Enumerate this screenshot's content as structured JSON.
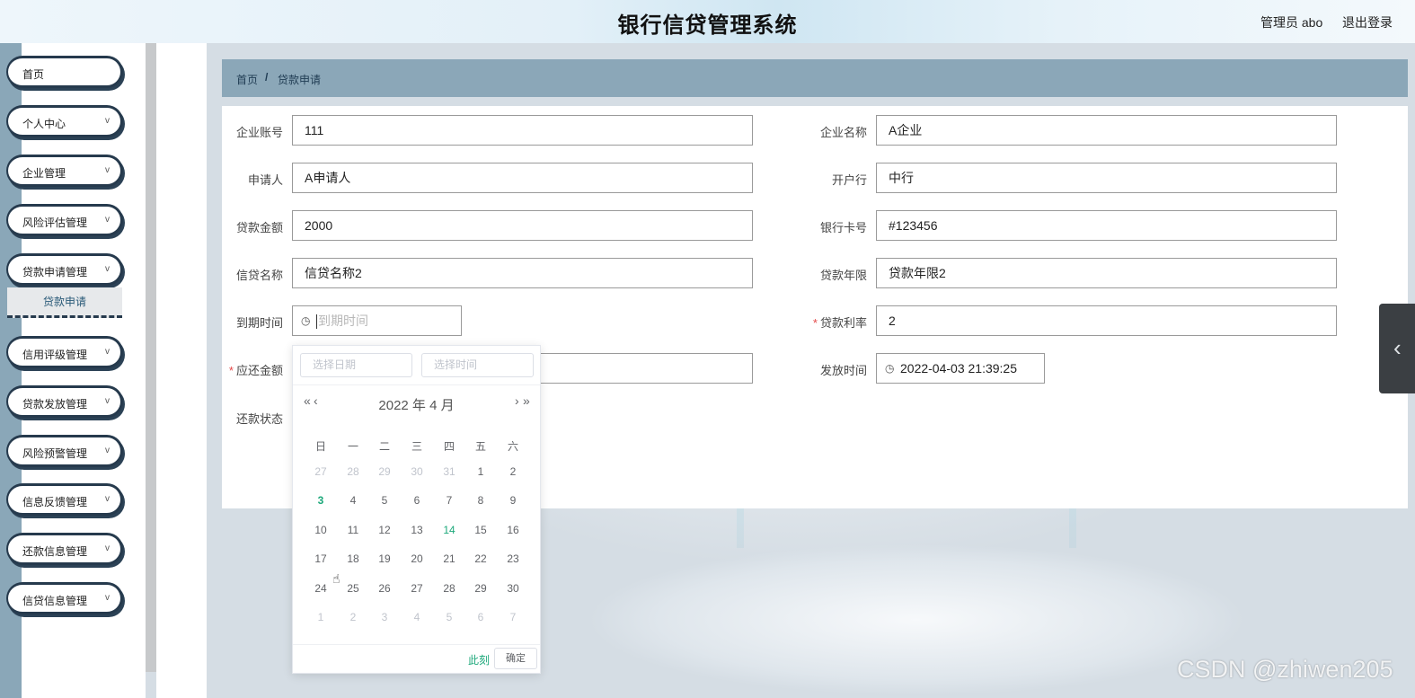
{
  "header": {
    "title": "银行信贷管理系统",
    "user": "管理员 abo",
    "logout": "退出登录"
  },
  "sidebar": {
    "items": [
      {
        "label": "首页"
      },
      {
        "label": "个人中心"
      },
      {
        "label": "企业管理"
      },
      {
        "label": "风险评估管理"
      },
      {
        "label": "贷款申请管理"
      },
      {
        "label": "信用评级管理"
      },
      {
        "label": "贷款发放管理"
      },
      {
        "label": "风险预警管理"
      },
      {
        "label": "信息反馈管理"
      },
      {
        "label": "还款信息管理"
      },
      {
        "label": "信贷信息管理"
      }
    ],
    "chevron": "v",
    "active_sub": "贷款申请"
  },
  "breadcrumb": {
    "home": "首页",
    "separator": "/",
    "current": "贷款申请"
  },
  "form": {
    "left": [
      {
        "label": "企业账号",
        "value": "111"
      },
      {
        "label": "申请人",
        "value": "A申请人"
      },
      {
        "label": "贷款金额",
        "value": "2000"
      },
      {
        "label": "信贷名称",
        "value": "信贷名称2"
      },
      {
        "label": "到期时间",
        "placeholder": "到期时间"
      },
      {
        "label": "应还金额",
        "required": "*",
        "value": ""
      },
      {
        "label": "还款状态"
      }
    ],
    "right": [
      {
        "label": "企业名称",
        "value": "A企业"
      },
      {
        "label": "开户行",
        "value": "中行"
      },
      {
        "label": "银行卡号",
        "value": "#123456"
      },
      {
        "label": "贷款年限",
        "value": "贷款年限2"
      },
      {
        "label": "贷款利率",
        "required": "*",
        "value": "2"
      },
      {
        "label": "发放时间",
        "value": "2022-04-03 21:39:25"
      }
    ]
  },
  "datepicker": {
    "date_placeholder": "选择日期",
    "time_placeholder": "选择时间",
    "prev_year": "«",
    "prev_month": "‹",
    "next_month": "›",
    "next_year": "»",
    "title": "2022 年  4 月",
    "weekdays": [
      "日",
      "一",
      "二",
      "三",
      "四",
      "五",
      "六"
    ],
    "weeks": [
      [
        "27",
        "28",
        "29",
        "30",
        "31",
        "1",
        "2"
      ],
      [
        "3",
        "4",
        "5",
        "6",
        "7",
        "8",
        "9"
      ],
      [
        "10",
        "11",
        "12",
        "13",
        "14",
        "15",
        "16"
      ],
      [
        "17",
        "18",
        "19",
        "20",
        "21",
        "22",
        "23"
      ],
      [
        "24",
        "25",
        "26",
        "27",
        "28",
        "29",
        "30"
      ],
      [
        "1",
        "2",
        "3",
        "4",
        "5",
        "6",
        "7"
      ]
    ],
    "today": "3",
    "highlighted": "14",
    "now_button": "此刻",
    "ok_button": "确定"
  },
  "side_tab_icon": "‹",
  "watermark": "CSDN @zhiwen205",
  "colors": {
    "sidebar_strip": "#8aa7b8",
    "breadcrumb_bg": "#8ba7b8",
    "menu_border": "#263a4d",
    "accent_green": "#1ca87a",
    "required": "#e54848"
  }
}
